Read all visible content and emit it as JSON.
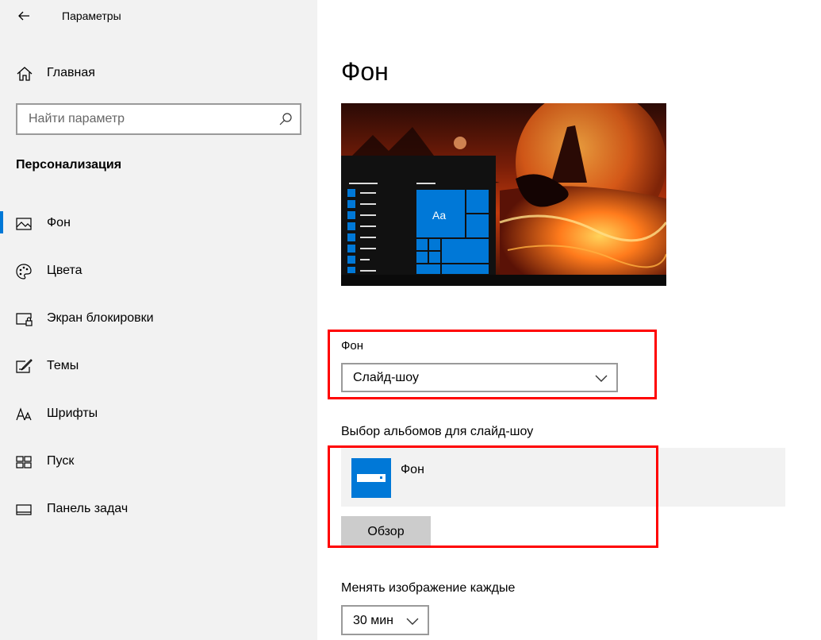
{
  "window": {
    "title": "Параметры"
  },
  "sidebar": {
    "home_label": "Главная",
    "search_placeholder": "Найти параметр",
    "section_title": "Персонализация",
    "items": [
      {
        "label": "Фон",
        "icon": "picture-icon",
        "selected": true
      },
      {
        "label": "Цвета",
        "icon": "palette-icon",
        "selected": false
      },
      {
        "label": "Экран блокировки",
        "icon": "lock-screen-icon",
        "selected": false
      },
      {
        "label": "Темы",
        "icon": "themes-icon",
        "selected": false
      },
      {
        "label": "Шрифты",
        "icon": "fonts-icon",
        "selected": false
      },
      {
        "label": "Пуск",
        "icon": "start-icon",
        "selected": false
      },
      {
        "label": "Панель задач",
        "icon": "taskbar-icon",
        "selected": false
      }
    ]
  },
  "main": {
    "page_title": "Фон",
    "preview": {
      "tile_text": "Aa"
    },
    "background": {
      "label": "Фон",
      "value": "Слайд-шоу"
    },
    "albums": {
      "label": "Выбор альбомов для слайд-шоу",
      "album_name": "Фон",
      "browse_label": "Обзор"
    },
    "change_every": {
      "label": "Менять изображение каждые",
      "value": "30 мин"
    }
  },
  "colors": {
    "accent": "#0078d7",
    "highlight": "#ff0000",
    "sidebar_bg": "#f2f2f2"
  }
}
